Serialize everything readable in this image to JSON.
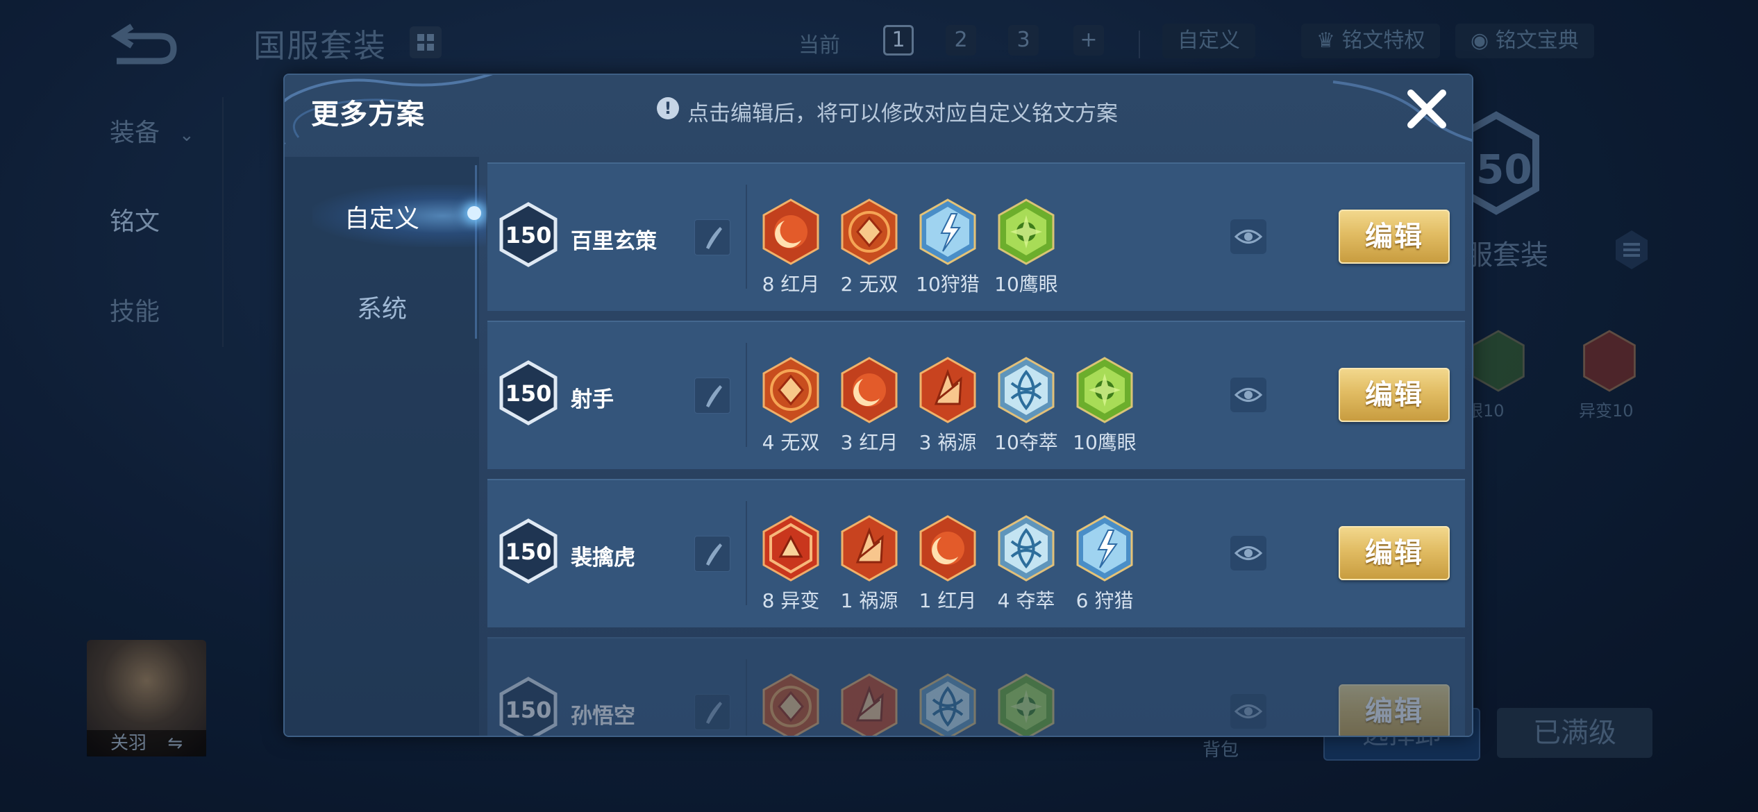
{
  "background": {
    "title": "国服套装",
    "tabs_label": "当前",
    "slots": [
      "1",
      "2",
      "3"
    ],
    "add_label": "+",
    "custom_label": "自定义",
    "privilege_label": "铭文特权",
    "codex_label": "铭文宝典",
    "left_menu": [
      {
        "label": "装备"
      },
      {
        "label": "铭文"
      },
      {
        "label": "技能"
      }
    ],
    "hero_name": "关羽",
    "hero_swap": "⇋",
    "backpack": "背包",
    "choose_button": "选择卸",
    "maxed_button": "已满级",
    "right_level": "50",
    "right_title": "服套装",
    "right_runes": [
      "眼10",
      "异变10"
    ]
  },
  "modal": {
    "title": "更多方案",
    "hint": "点击编辑后，将可以修改对应自定义铭文方案",
    "hint_icon": "!",
    "tabs": [
      {
        "label": "自定义",
        "active": true
      },
      {
        "label": "系统",
        "active": false
      }
    ],
    "edit_label": "编辑",
    "plans": [
      {
        "level": "150",
        "name": "百里玄策",
        "runes": [
          {
            "icon": "red-moon",
            "label": "8 红月"
          },
          {
            "icon": "wushuang",
            "label": "2 无双"
          },
          {
            "icon": "hunting",
            "label": "10狩猎"
          },
          {
            "icon": "hawkeye",
            "label": "10鹰眼"
          }
        ]
      },
      {
        "level": "150",
        "name": "射手",
        "runes": [
          {
            "icon": "wushuang",
            "label": "4 无双"
          },
          {
            "icon": "red-moon",
            "label": "3 红月"
          },
          {
            "icon": "huoyuan",
            "label": "3 祸源"
          },
          {
            "icon": "duocui",
            "label": "10夺萃"
          },
          {
            "icon": "hawkeye",
            "label": "10鹰眼"
          }
        ]
      },
      {
        "level": "150",
        "name": "裴擒虎",
        "runes": [
          {
            "icon": "yibian",
            "label": "8 异变"
          },
          {
            "icon": "huoyuan",
            "label": "1 祸源"
          },
          {
            "icon": "red-moon",
            "label": "1 红月"
          },
          {
            "icon": "duocui",
            "label": "4 夺萃"
          },
          {
            "icon": "hunting",
            "label": "6 狩猎"
          }
        ]
      },
      {
        "level": "150",
        "name": "孙悟空",
        "runes": [
          {
            "icon": "wushuang",
            "label": ""
          },
          {
            "icon": "huoyuan",
            "label": ""
          },
          {
            "icon": "duocui",
            "label": ""
          },
          {
            "icon": "hawkeye",
            "label": ""
          }
        ]
      }
    ]
  }
}
